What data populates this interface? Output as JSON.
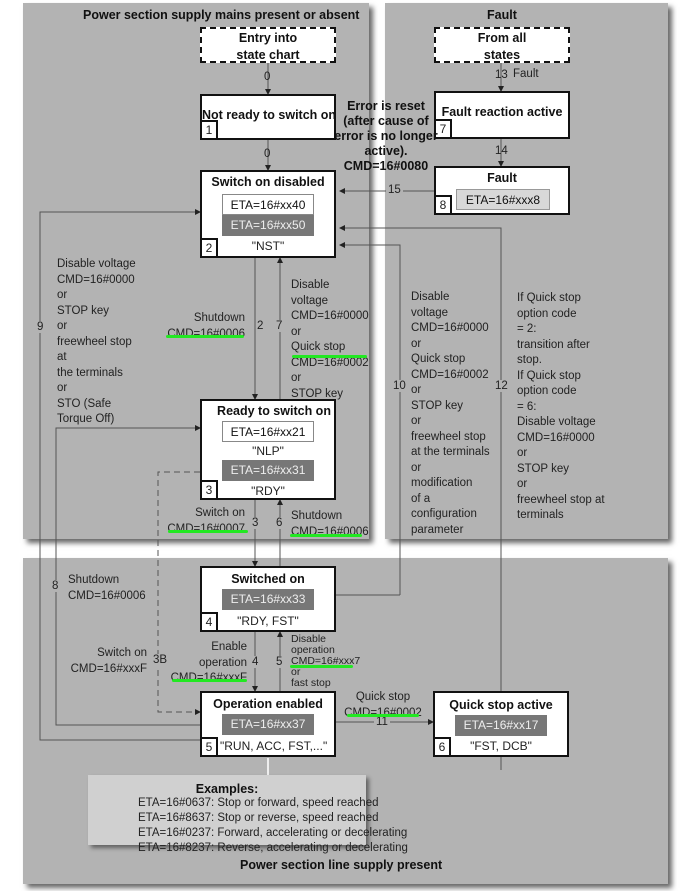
{
  "panels": {
    "mains": "Power section supply mains present or absent",
    "fault": "Fault",
    "line": "Power section line supply present"
  },
  "entry": {
    "line1": "Entry into",
    "line2": "state chart"
  },
  "from_all": {
    "line1": "From all",
    "line2": "states"
  },
  "states": [
    {
      "num": "1",
      "title": "Not ready to switch on"
    },
    {
      "num": "2",
      "title": "Switch on disabled",
      "eta": [
        "ETA=16#xx40",
        "ETA=16#xx50"
      ],
      "code": "\"NST\""
    },
    {
      "num": "3",
      "title": "Ready to switch on",
      "eta": [
        "ETA=16#xx21",
        "ETA=16#xx31"
      ],
      "codes": [
        "\"NLP\"",
        "\"RDY\""
      ]
    },
    {
      "num": "4",
      "title": "Switched on",
      "eta": [
        "ETA=16#xx33"
      ],
      "code": "\"RDY, FST\""
    },
    {
      "num": "5",
      "title": "Operation enabled",
      "eta": [
        "ETA=16#xx37"
      ],
      "code": "\"RUN, ACC, FST,...\""
    },
    {
      "num": "6",
      "title": "Quick stop active",
      "eta": [
        "ETA=16#xx17"
      ],
      "code": "\"FST, DCB\""
    },
    {
      "num": "7",
      "title": "Fault reaction active"
    },
    {
      "num": "8",
      "title": "Fault",
      "eta": [
        "ETA=16#xxx8"
      ]
    }
  ],
  "transitions": {
    "t0a": "0",
    "t0b": "0",
    "t2": "2",
    "t3": "3",
    "t3b": "3B",
    "t4": "4",
    "t5": "5",
    "t6": "6",
    "t7": "7",
    "t8": "8",
    "t9": "9",
    "t10": "10",
    "t11": "11",
    "t12": "12",
    "t13": "13",
    "t14": "14",
    "t15": "15",
    "fault_label": "Fault"
  },
  "labels": {
    "error_reset": [
      "Error is reset",
      "(after cause of",
      "error is no longer",
      "active).",
      "CMD=16#0080"
    ],
    "t9": [
      "Disable voltage",
      "CMD=16#0000",
      "or",
      "STOP key",
      "or",
      "freewheel stop",
      "at",
      "the terminals",
      "or",
      "STO (Safe",
      "Torque Off)"
    ],
    "t2": [
      "Shutdown",
      "CMD=16#0006"
    ],
    "t7": [
      "Disable",
      "voltage",
      "CMD=16#0000",
      "or",
      "Quick stop",
      "CMD=16#0002",
      "or",
      "STOP key"
    ],
    "t10": [
      "Disable",
      "voltage",
      "CMD=16#0000",
      "or",
      "Quick stop",
      "CMD=16#0002",
      "or",
      "STOP key",
      "or",
      "freewheel stop",
      "at the terminals",
      "or",
      "modification",
      "of a",
      "configuration",
      "parameter"
    ],
    "t12": [
      "If Quick stop",
      "option code",
      "= 2:",
      "transition after",
      "stop.",
      "If Quick stop",
      "option code",
      "= 6:",
      "Disable voltage",
      "CMD=16#0000",
      "or",
      "STOP key",
      "or",
      "freewheel stop at",
      "terminals"
    ],
    "t3": [
      "Switch on",
      "CMD=16#0007"
    ],
    "t6": [
      "Shutdown",
      "CMD=16#0006"
    ],
    "t8": [
      "Shutdown",
      "CMD=16#0006"
    ],
    "t3b": [
      "Switch on",
      "CMD=16#xxxF"
    ],
    "t4": [
      "Enable",
      "operation",
      "CMD=16#xxxF"
    ],
    "t5": [
      "Disable",
      "operation",
      "CMD=16#xxx7",
      "or",
      "fast stop"
    ],
    "t11": [
      "Quick stop",
      "CMD=16#0002"
    ]
  },
  "examples": {
    "title": "Examples:",
    "rows": [
      "ETA=16#0637: Stop or forward, speed reached",
      "ETA=16#8637: Stop or reverse, speed reached",
      "ETA=16#0237: Forward, accelerating or decelerating",
      "ETA=16#8237: Reverse, accelerating or decelerating"
    ]
  },
  "colors": {
    "highlight": "#22e822",
    "panel": "#b3b3b3",
    "eta_dark": "#777777"
  }
}
